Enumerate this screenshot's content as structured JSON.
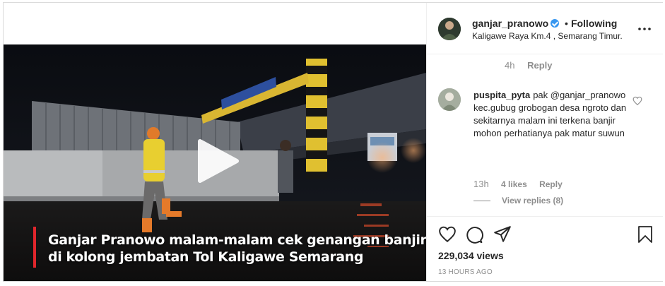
{
  "post": {
    "caption_line1": "Ganjar Pranowo malam-malam cek genangan banjir",
    "caption_line2": "di kolong jembatan Tol Kaligawe Semarang",
    "accent_color": "#e0262c"
  },
  "header": {
    "username": "ganjar_pranowo",
    "separator": "•",
    "follow_status": "Following",
    "location": "Kaligawe Raya Km.4 , Semarang Timur.",
    "verified_color": "#3897f0"
  },
  "previous_comment": {
    "time": "4h",
    "reply_label": "Reply"
  },
  "comment": {
    "username": "puspita_pyta",
    "text": "pak @ganjar_pranowo kec.gubug grobogan desa ngroto dan sekitarnya malam ini terkena banjir mohon perhatianya pak matur suwun",
    "time": "13h",
    "likes": "4 likes",
    "reply_label": "Reply",
    "view_replies": "View replies (8)"
  },
  "actions": {
    "views": "229,034 views",
    "timestamp": "13 HOURS AGO"
  },
  "icons": [
    "play-icon",
    "verified-icon",
    "more-icon",
    "heart-icon",
    "comment-icon",
    "share-icon",
    "save-icon",
    "like-icon"
  ]
}
